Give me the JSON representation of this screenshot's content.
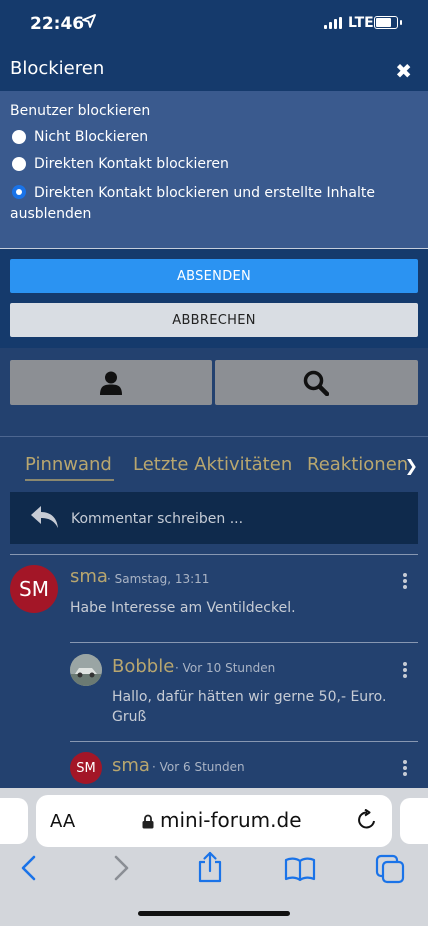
{
  "status_bar": {
    "time": "22:46",
    "network": "LTE"
  },
  "modal": {
    "title": "Blockieren",
    "section_label": "Benutzer blockieren",
    "options": [
      {
        "label": "Nicht Blockieren",
        "checked": false
      },
      {
        "label": "Direkten Kontakt blockieren",
        "checked": false
      },
      {
        "label": "Direkten Kontakt blockieren und erstellte Inhalte ausblenden",
        "checked": true
      }
    ],
    "submit_label": "ABSENDEN",
    "cancel_label": "ABBRECHEN"
  },
  "toolbar": {
    "left_icon": "user-icon",
    "right_icon": "search-icon"
  },
  "tabs": [
    "Pinnwand",
    "Letzte Aktivitäten",
    "Reaktionen"
  ],
  "comment_box": {
    "placeholder": "Kommentar schreiben ..."
  },
  "posts": [
    {
      "avatar_text": "SM",
      "author": "sma",
      "meta": "· Samstag, 13:11",
      "text": "Habe Interesse am Ventildeckel."
    },
    {
      "avatar_text": "",
      "author": "Bobble",
      "meta": "· Vor 10 Stunden",
      "text_line1": "Hallo, dafür hätten wir gerne 50,- Euro.",
      "text_line2": "Gruß"
    },
    {
      "avatar_text": "SM",
      "author": "sma",
      "meta": "· Vor 6 Stunden"
    }
  ],
  "safari": {
    "aa_label": "AA",
    "url": "mini-forum.de"
  },
  "colors": {
    "accent_gold": "#b8a66f",
    "submit_blue": "#2b93f2",
    "header_navy": "#153a6c",
    "avatar_red": "#a31627"
  }
}
